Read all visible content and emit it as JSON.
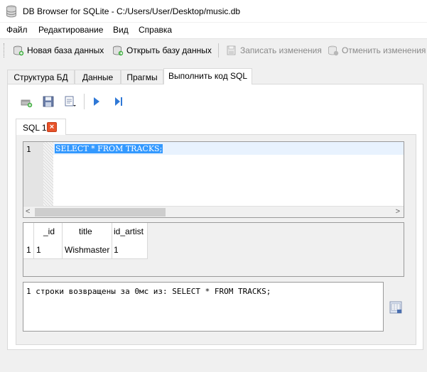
{
  "window": {
    "title": "DB Browser for SQLite - C:/Users/User/Desktop/music.db"
  },
  "menu": {
    "items": [
      {
        "label": "Файл"
      },
      {
        "label": "Редактирование"
      },
      {
        "label": "Вид"
      },
      {
        "label": "Справка"
      }
    ]
  },
  "toolbar": {
    "new_db": "Новая база данных",
    "open_db": "Открыть базу данных",
    "write_changes": "Записать изменения",
    "revert_changes": "Отменить изменения"
  },
  "tabs": [
    {
      "label": "Структура БД"
    },
    {
      "label": "Данные"
    },
    {
      "label": "Прагмы"
    },
    {
      "label": "Выполнить код SQL",
      "active": true
    }
  ],
  "sql_tab": {
    "label": "SQL 1",
    "close_glyph": "×"
  },
  "editor": {
    "line_number": "1",
    "code": "SELECT * FROM TRACKS;"
  },
  "scrollbar": {
    "left_arrow": "<",
    "right_arrow": ">"
  },
  "results": {
    "columns": [
      "_id",
      "title",
      "id_artist"
    ],
    "rows": [
      {
        "row_header": "1",
        "cells": [
          "1",
          "Wishmaster",
          "1"
        ]
      }
    ]
  },
  "message": {
    "text": "1 строки возвращены за 0мс из: SELECT * FROM TRACKS;"
  },
  "colors": {
    "selection": "#3399ff",
    "close_tab": "#e8532a",
    "current_line": "#e8f2fe"
  }
}
